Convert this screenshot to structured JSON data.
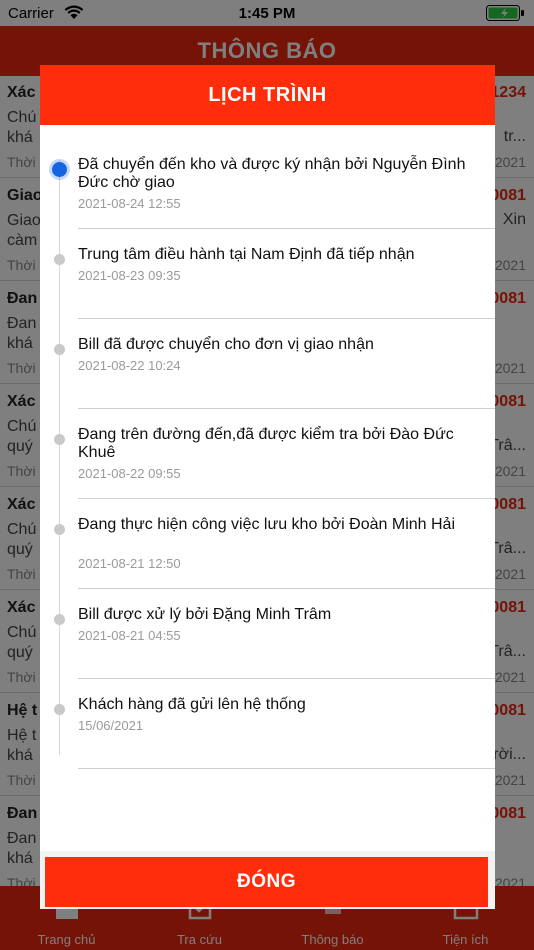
{
  "status_bar": {
    "carrier": "Carrier",
    "time": "1:45 PM"
  },
  "app": {
    "header_title": "THÔNG BÁO",
    "notifications": [
      {
        "title": "Xác",
        "code": "1234",
        "body": "Chú",
        "body2": "khá",
        "tail": "tr...",
        "time": "Thời",
        "date": "2021"
      },
      {
        "title": "Giao",
        "code": "0081",
        "body": "Giao",
        "body2": "càm",
        "tail": "Xin",
        "time": "Thời",
        "date": "2021"
      },
      {
        "title": "Đan",
        "code": "0081",
        "body": "Đan",
        "body2": "khá",
        "tail": "",
        "time": "Thời",
        "date": "2021"
      },
      {
        "title": "Xác",
        "code": "0081",
        "body": "Chú",
        "body2": "quý",
        "tail": "Trâ...",
        "time": "Thời",
        "date": "2021"
      },
      {
        "title": "Xác",
        "code": "0081",
        "body": "Chú",
        "body2": "quý",
        "tail": "Trâ...",
        "time": "Thời",
        "date": "2021"
      },
      {
        "title": "Xác",
        "code": "0081",
        "body": "Chú",
        "body2": "quý",
        "tail": "Trâ...",
        "time": "Thời",
        "date": "2021"
      },
      {
        "title": "Hệ t",
        "code": "0081",
        "body": "Hệ t",
        "body2": "khá",
        "tail": "rời...",
        "time": "Thời",
        "date": "2021"
      },
      {
        "title": "Đan",
        "code": "0081",
        "body": "Đan",
        "body2": "khá",
        "tail": "",
        "time": "Thời",
        "date": "2021"
      }
    ],
    "tabs": [
      {
        "label": "Trang chủ"
      },
      {
        "label": "Tra cứu"
      },
      {
        "label": "Thông báo"
      },
      {
        "label": "Tiện ích"
      }
    ]
  },
  "modal": {
    "title": "LỊCH TRÌNH",
    "close_label": "ĐÓNG",
    "entries": [
      {
        "text": "Đã chuyển đến kho và được ký nhận bởi Nguyễn Đình Đức chờ giao",
        "time": "2021-08-24 12:55",
        "active": true
      },
      {
        "text": "Trung tâm điều hành tại Nam Định đã tiếp nhận",
        "time": "2021-08-23 09:35",
        "active": false
      },
      {
        "text": "Bill đã được chuyển cho đơn vị giao nhận",
        "time": "2021-08-22 10:24",
        "active": false
      },
      {
        "text": "Đang trên đường đến,đã được kiểm tra bởi Đào Đức Khuê",
        "time": "2021-08-22 09:55",
        "active": false
      },
      {
        "text": "Đang thực hiện công việc lưu kho bởi Đoàn Minh Hải",
        "time": "2021-08-21 12:50",
        "active": false
      },
      {
        "text": "Bill được xử lý bởi Đặng Minh Trâm",
        "time": "2021-08-21 04:55",
        "active": false
      },
      {
        "text": "Khách hàng đã gửi lên hệ thống",
        "time": "15/06/2021",
        "active": false
      }
    ]
  },
  "colors": {
    "brand_red": "#e8260c",
    "modal_red": "#ff2d0c",
    "active_dot": "#1565e0"
  }
}
